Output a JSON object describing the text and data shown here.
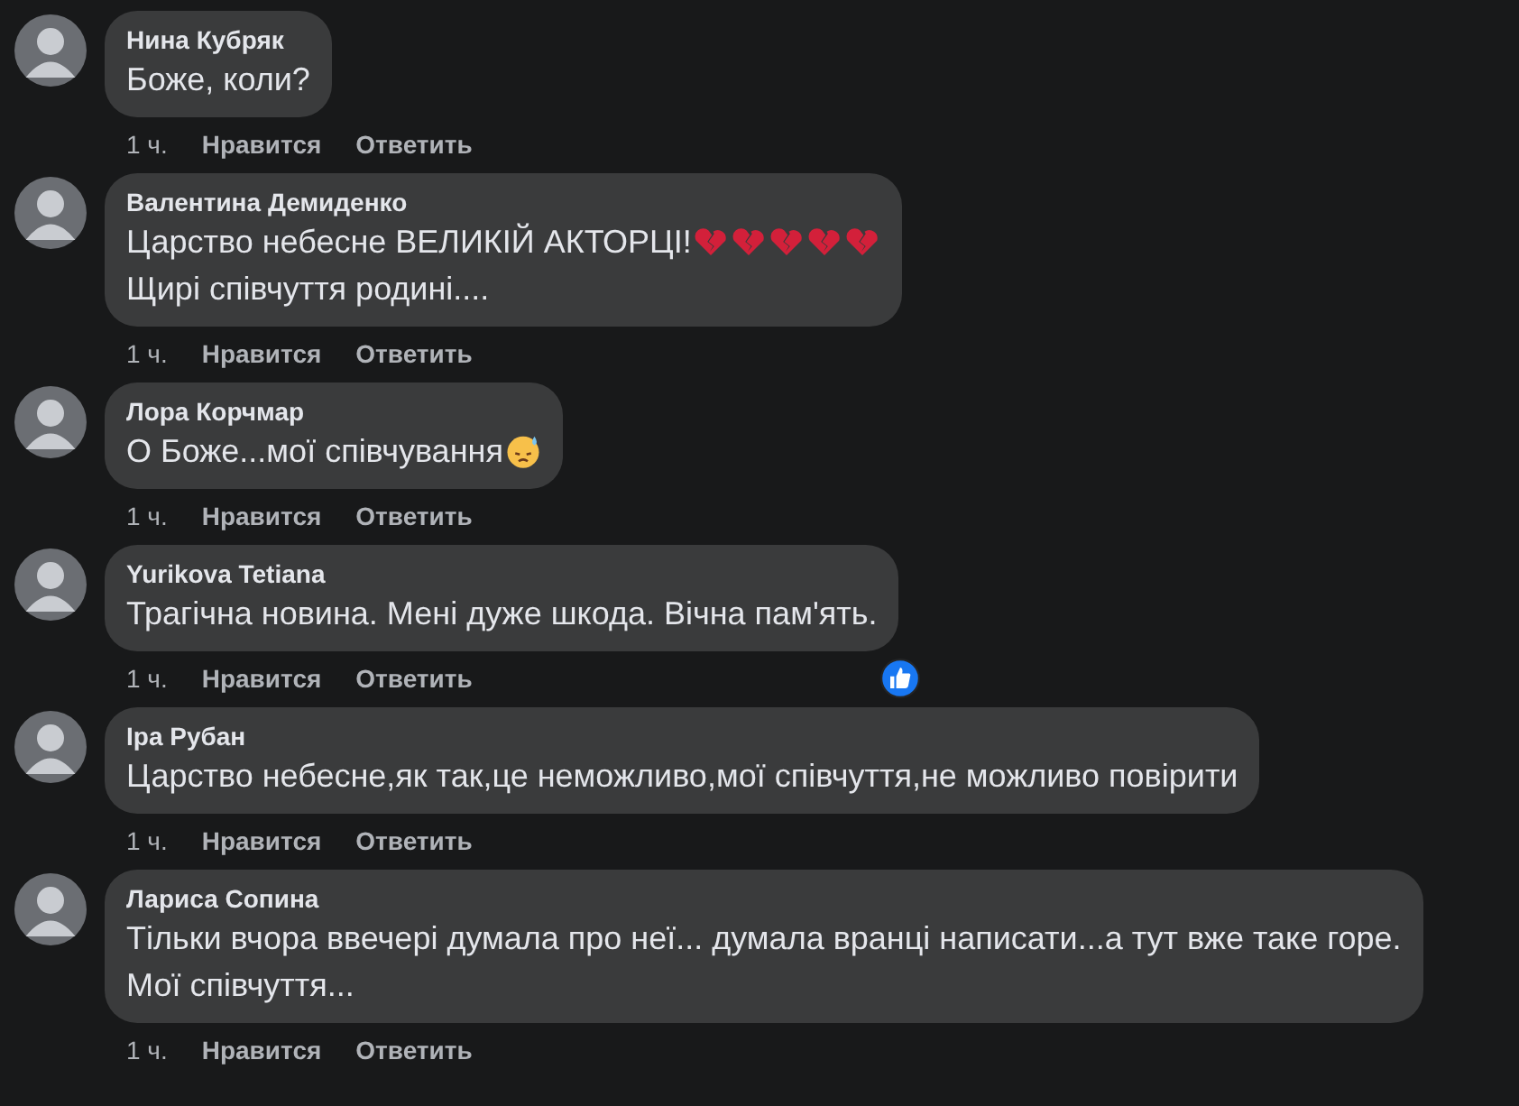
{
  "comments": [
    {
      "author": "Нина Кубряк",
      "lines": [
        [
          {
            "kind": "text",
            "text": "Боже, коли?"
          }
        ]
      ],
      "time": "1 ч.",
      "like": "Нравится",
      "reply": "Ответить"
    },
    {
      "author": "Валентина Демиденко",
      "lines": [
        [
          {
            "kind": "text",
            "text": "Царство небесне ВЕЛИКІЙ АКТОРЦІ! "
          },
          {
            "kind": "broken-heart"
          },
          {
            "kind": "broken-heart"
          },
          {
            "kind": "broken-heart"
          },
          {
            "kind": "broken-heart"
          },
          {
            "kind": "broken-heart"
          }
        ],
        [
          {
            "kind": "text",
            "text": "Щирі співчуття родині...."
          }
        ]
      ],
      "time": "1 ч.",
      "like": "Нравится",
      "reply": "Ответить"
    },
    {
      "author": "Лора Корчмар",
      "lines": [
        [
          {
            "kind": "text",
            "text": "О Боже...мої співчування"
          },
          {
            "kind": "sweat-face"
          }
        ]
      ],
      "time": "1 ч.",
      "like": "Нравится",
      "reply": "Ответить"
    },
    {
      "author": "Yurikova Tetiana",
      "lines": [
        [
          {
            "kind": "text",
            "text": "Трагічна новина. Мені дуже шкода. Вічна пам'ять."
          }
        ]
      ],
      "time": "1 ч.",
      "like": "Нравится",
      "reply": "Ответить",
      "liked_badge": true
    },
    {
      "author": "Іра Рубан",
      "lines": [
        [
          {
            "kind": "text",
            "text": "Царство небесне,як так,це неможливо,мої співчуття,не можливо повірити"
          }
        ]
      ],
      "time": "1 ч.",
      "like": "Нравится",
      "reply": "Ответить"
    },
    {
      "author": "Лариса Сопина",
      "lines": [
        [
          {
            "kind": "text",
            "text": "Тільки вчора ввечері думала про неї... думала вранці написати...а тут вже таке горе."
          }
        ],
        [
          {
            "kind": "text",
            "text": "Мої співчуття..."
          }
        ]
      ],
      "time": "1 ч.",
      "like": "Нравится",
      "reply": "Ответить"
    }
  ]
}
